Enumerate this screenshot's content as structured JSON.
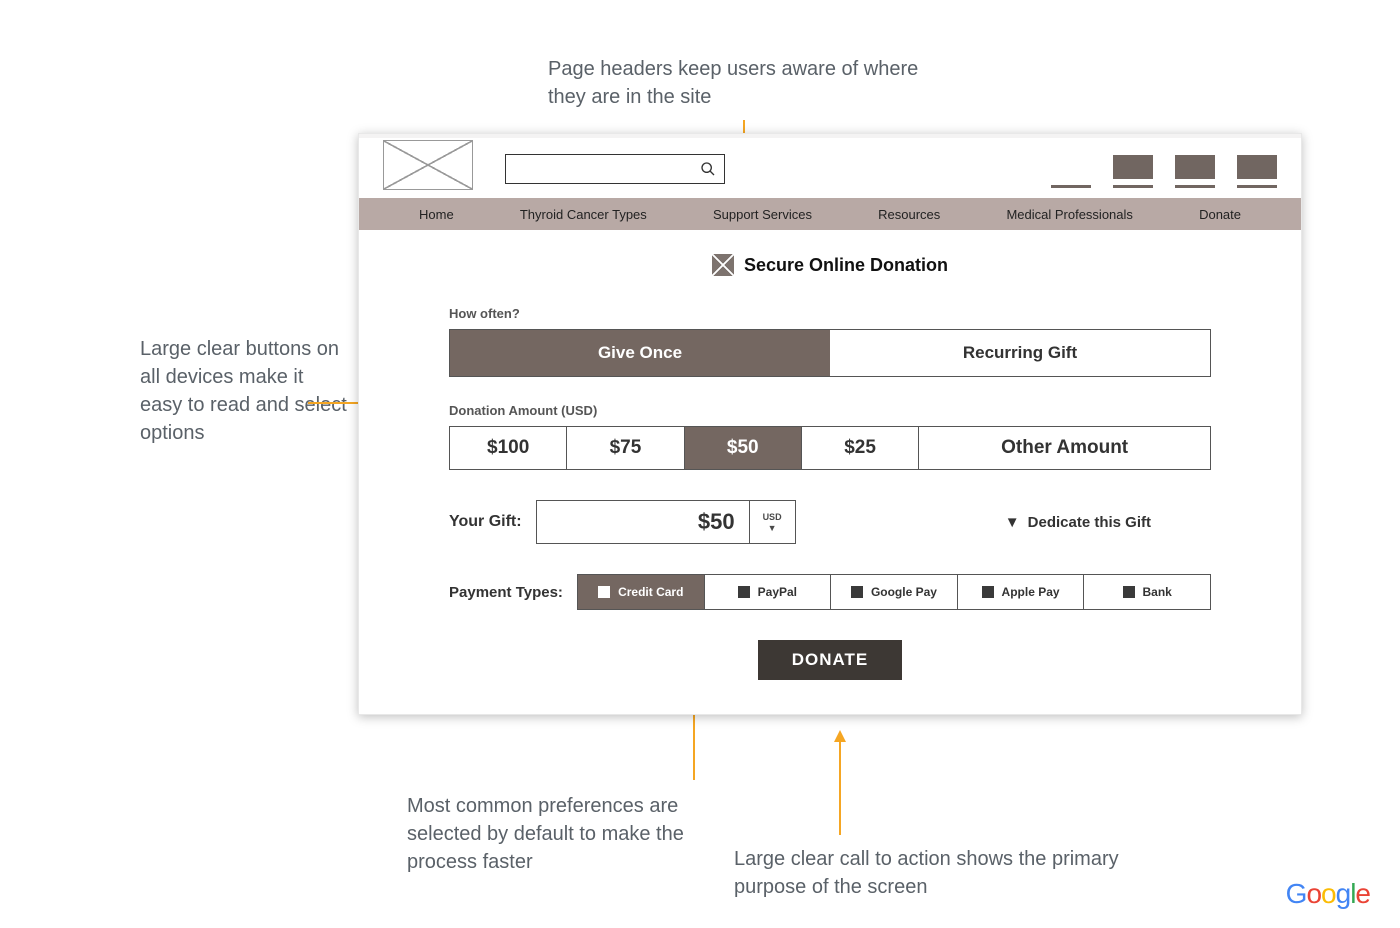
{
  "annotations": {
    "top": "Page headers keep users aware of where they are in the site",
    "left": "Large clear buttons on all devices make it easy to read and select options",
    "bottom_left": "Most common preferences are selected by default to make the process faster",
    "bottom_right": "Large clear call to action shows the primary purpose of the screen"
  },
  "nav": [
    "Home",
    "Thyroid Cancer Types",
    "Support Services",
    "Resources",
    "Medical Professionals",
    "Donate"
  ],
  "page_title": "Secure Online Donation",
  "sections": {
    "how_often": {
      "label": "How often?",
      "options": [
        "Give Once",
        "Recurring Gift"
      ],
      "selected": 0
    },
    "amount": {
      "label": "Donation Amount (USD)",
      "options": [
        "$100",
        "$75",
        "$50",
        "$25",
        "Other Amount"
      ],
      "selected": 2
    },
    "gift": {
      "label": "Your Gift:",
      "value": "$50",
      "currency": "USD"
    },
    "dedicate": "Dedicate this Gift",
    "payment": {
      "label": "Payment Types:",
      "options": [
        "Credit Card",
        "PayPal",
        "Google Pay",
        "Apple Pay",
        "Bank"
      ],
      "selected": 0
    },
    "cta": "DONATE"
  },
  "brand": "Google"
}
